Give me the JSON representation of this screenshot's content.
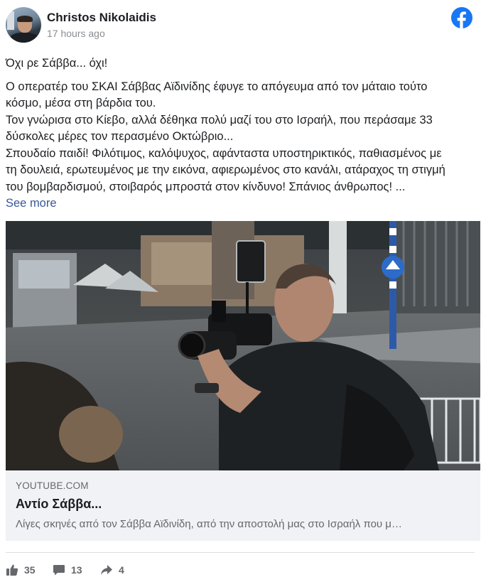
{
  "post": {
    "author": "Christos Nikolaidis",
    "time": "17 hours ago",
    "greeting": "Όχι ρε Σάββα... όχι!",
    "body_lines": [
      "Ο οπερατέρ του ΣΚΑΙ Σάββας Αϊδινίδης έφυγε το απόγευμα από τον μάταιο τούτο",
      "κόσμο, μέσα στη βάρδια του.",
      "Τον γνώρισα στο Κίεβο, αλλά δέθηκα πολύ μαζί του στο Ισραήλ, που περάσαμε 33",
      "δύσκολες μέρες τον περασμένο Οκτώβριο...",
      "Σπουδαίο παιδί! Φιλότιμος, καλόψυχος, αφάνταστα υποστηρικτικός, παθιασμένος με",
      "τη δουλειά, ερωτευμένος με την εικόνα, αφιερωμένος στο κανάλι, ατάραχος τη στιγμή",
      "του βομβαρδισμού, στοιβαρός μπροστά στον κίνδυνο! Σπάνιος άνθρωπος! ..."
    ],
    "see_more": "See more",
    "platform_icon": "facebook-icon"
  },
  "link_preview": {
    "domain": "YOUTUBE.COM",
    "title": "Αντίο Σάββα...",
    "description": "Λίγες σκηνές από τον Σάββα Αϊδινίδη, από την αποστολή μας στο Ισραήλ που μ…"
  },
  "stats": {
    "likes": "35",
    "comments": "13",
    "shares": "4"
  },
  "colors": {
    "facebook_blue": "#1877f2",
    "link_blue": "#385898",
    "muted": "#65676b"
  }
}
